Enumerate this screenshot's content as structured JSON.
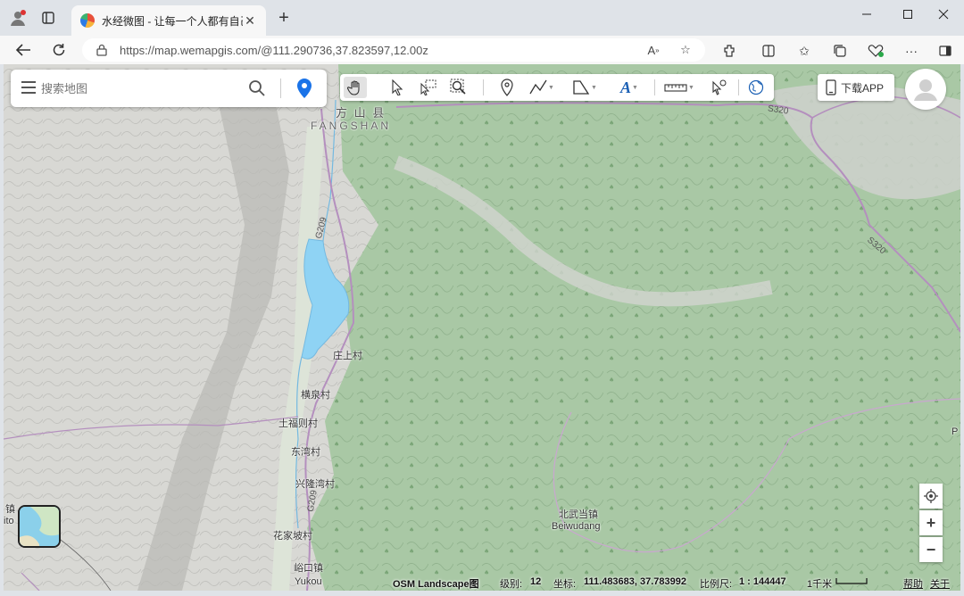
{
  "browser": {
    "tab_title": "水经微图 - 让每一个人都有自己的",
    "url": "https://map.wemapgis.com/@111.290736,37.823597,12.00z"
  },
  "search": {
    "placeholder": "搜索地图"
  },
  "toolbar": {
    "tools": [
      "pan-hand",
      "select-arrow",
      "box-select",
      "zoom-box",
      "marker",
      "polyline",
      "polygon",
      "text",
      "measure",
      "query-arrow",
      "globe"
    ]
  },
  "download_app_label": "下载APP",
  "map_labels": {
    "fangshan_cn": "方 山 县",
    "fangshan_en": "FANGSHAN",
    "zhuangshang": "庄上村",
    "hengquan": "横泉村",
    "tufuze": "土福则村",
    "dongwan": "东湾村",
    "xinglongwan": "兴隆湾村",
    "huajiapo": "花家坡村",
    "yukou_cn": "峪口镇",
    "yukou_en": "Yukou",
    "beiwudang_cn": "北武当镇",
    "beiwudang_en": "Beiwudang",
    "zhen_left": "镇",
    "zhen_left2": "ito",
    "p_right": "P"
  },
  "road_labels": {
    "g209_a": "G209",
    "g209_b": "G209",
    "s320_a": "S320",
    "s320_b": "S320"
  },
  "status": {
    "layer": "OSM Landscape图",
    "level_label": "级别:",
    "level_value": "12",
    "coord_label": "坐标:",
    "coord_value": "111.483683, 37.783992",
    "scale_label": "比例尺:",
    "scale_value": "1 : 144447",
    "scalebar": "1千米",
    "help": "帮助",
    "about": "关于"
  },
  "colors": {
    "water": "#8fd3f4",
    "forest": "#a7c9a5",
    "terrain": "#d6d6d2",
    "road": "#b48fbe",
    "accent": "#1a73e8"
  }
}
